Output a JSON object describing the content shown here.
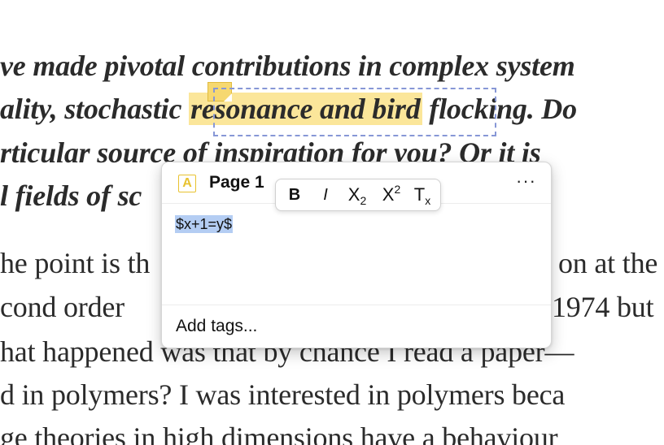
{
  "document": {
    "lines": [
      {
        "pre": "ve made pivotal contributions in complex system"
      },
      {
        "pre": "ality, stochastic ",
        "highlight": "resonance and bird",
        "post": " flocking. Do"
      },
      {
        "pre": "rticular source of inspiration for you? Or it is "
      },
      {
        "pre": "l fields of sc"
      },
      {
        "pre": "he point is th",
        "post": "on at the l"
      },
      {
        "pre": "cond order ",
        "post": "1974 but"
      },
      {
        "pre": "hat happened was that by chance I read a paper—"
      },
      {
        "pre": "d in polymers? I was interested in polymers beca"
      },
      {
        "pre": "ge theories in high dimensions have a behaviour"
      }
    ]
  },
  "annotation_popup": {
    "page_label": "Page 1",
    "icon": "annotation-highlight-icon",
    "more_label": "···",
    "comment_text": "$x+1=y$",
    "tags_label": "Add tags..."
  },
  "format_toolbar": {
    "bold_label": "B",
    "italic_label": "I",
    "subscript_base": "X",
    "subscript_mark": "2",
    "superscript_base": "X",
    "superscript_mark": "2",
    "clear_base": "T",
    "clear_mark": "x"
  },
  "colors": {
    "highlight": "#fbe69a",
    "selection": "#b4cdf3",
    "selection_border": "#8797d6",
    "annotation_icon": "#e8c230"
  }
}
